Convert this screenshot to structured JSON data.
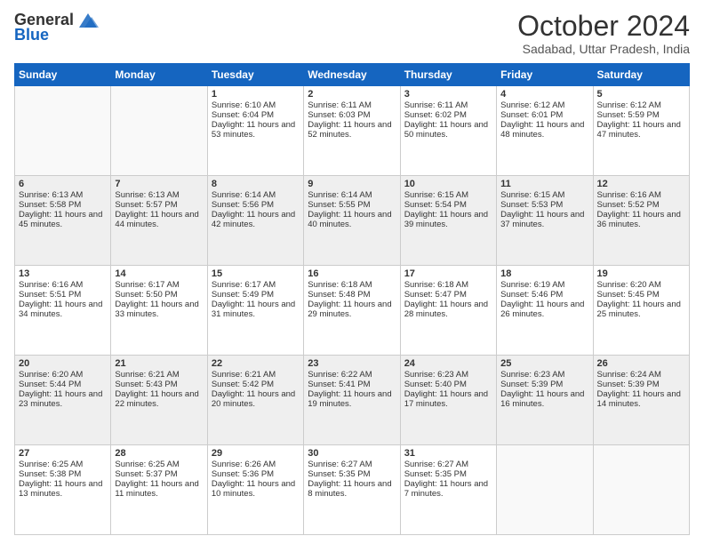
{
  "logo": {
    "line1": "General",
    "line2": "Blue"
  },
  "title": "October 2024",
  "subtitle": "Sadabad, Uttar Pradesh, India",
  "headers": [
    "Sunday",
    "Monday",
    "Tuesday",
    "Wednesday",
    "Thursday",
    "Friday",
    "Saturday"
  ],
  "weeks": [
    [
      {
        "day": "",
        "sunrise": "",
        "sunset": "",
        "daylight": ""
      },
      {
        "day": "",
        "sunrise": "",
        "sunset": "",
        "daylight": ""
      },
      {
        "day": "1",
        "sunrise": "Sunrise: 6:10 AM",
        "sunset": "Sunset: 6:04 PM",
        "daylight": "Daylight: 11 hours and 53 minutes."
      },
      {
        "day": "2",
        "sunrise": "Sunrise: 6:11 AM",
        "sunset": "Sunset: 6:03 PM",
        "daylight": "Daylight: 11 hours and 52 minutes."
      },
      {
        "day": "3",
        "sunrise": "Sunrise: 6:11 AM",
        "sunset": "Sunset: 6:02 PM",
        "daylight": "Daylight: 11 hours and 50 minutes."
      },
      {
        "day": "4",
        "sunrise": "Sunrise: 6:12 AM",
        "sunset": "Sunset: 6:01 PM",
        "daylight": "Daylight: 11 hours and 48 minutes."
      },
      {
        "day": "5",
        "sunrise": "Sunrise: 6:12 AM",
        "sunset": "Sunset: 5:59 PM",
        "daylight": "Daylight: 11 hours and 47 minutes."
      }
    ],
    [
      {
        "day": "6",
        "sunrise": "Sunrise: 6:13 AM",
        "sunset": "Sunset: 5:58 PM",
        "daylight": "Daylight: 11 hours and 45 minutes."
      },
      {
        "day": "7",
        "sunrise": "Sunrise: 6:13 AM",
        "sunset": "Sunset: 5:57 PM",
        "daylight": "Daylight: 11 hours and 44 minutes."
      },
      {
        "day": "8",
        "sunrise": "Sunrise: 6:14 AM",
        "sunset": "Sunset: 5:56 PM",
        "daylight": "Daylight: 11 hours and 42 minutes."
      },
      {
        "day": "9",
        "sunrise": "Sunrise: 6:14 AM",
        "sunset": "Sunset: 5:55 PM",
        "daylight": "Daylight: 11 hours and 40 minutes."
      },
      {
        "day": "10",
        "sunrise": "Sunrise: 6:15 AM",
        "sunset": "Sunset: 5:54 PM",
        "daylight": "Daylight: 11 hours and 39 minutes."
      },
      {
        "day": "11",
        "sunrise": "Sunrise: 6:15 AM",
        "sunset": "Sunset: 5:53 PM",
        "daylight": "Daylight: 11 hours and 37 minutes."
      },
      {
        "day": "12",
        "sunrise": "Sunrise: 6:16 AM",
        "sunset": "Sunset: 5:52 PM",
        "daylight": "Daylight: 11 hours and 36 minutes."
      }
    ],
    [
      {
        "day": "13",
        "sunrise": "Sunrise: 6:16 AM",
        "sunset": "Sunset: 5:51 PM",
        "daylight": "Daylight: 11 hours and 34 minutes."
      },
      {
        "day": "14",
        "sunrise": "Sunrise: 6:17 AM",
        "sunset": "Sunset: 5:50 PM",
        "daylight": "Daylight: 11 hours and 33 minutes."
      },
      {
        "day": "15",
        "sunrise": "Sunrise: 6:17 AM",
        "sunset": "Sunset: 5:49 PM",
        "daylight": "Daylight: 11 hours and 31 minutes."
      },
      {
        "day": "16",
        "sunrise": "Sunrise: 6:18 AM",
        "sunset": "Sunset: 5:48 PM",
        "daylight": "Daylight: 11 hours and 29 minutes."
      },
      {
        "day": "17",
        "sunrise": "Sunrise: 6:18 AM",
        "sunset": "Sunset: 5:47 PM",
        "daylight": "Daylight: 11 hours and 28 minutes."
      },
      {
        "day": "18",
        "sunrise": "Sunrise: 6:19 AM",
        "sunset": "Sunset: 5:46 PM",
        "daylight": "Daylight: 11 hours and 26 minutes."
      },
      {
        "day": "19",
        "sunrise": "Sunrise: 6:20 AM",
        "sunset": "Sunset: 5:45 PM",
        "daylight": "Daylight: 11 hours and 25 minutes."
      }
    ],
    [
      {
        "day": "20",
        "sunrise": "Sunrise: 6:20 AM",
        "sunset": "Sunset: 5:44 PM",
        "daylight": "Daylight: 11 hours and 23 minutes."
      },
      {
        "day": "21",
        "sunrise": "Sunrise: 6:21 AM",
        "sunset": "Sunset: 5:43 PM",
        "daylight": "Daylight: 11 hours and 22 minutes."
      },
      {
        "day": "22",
        "sunrise": "Sunrise: 6:21 AM",
        "sunset": "Sunset: 5:42 PM",
        "daylight": "Daylight: 11 hours and 20 minutes."
      },
      {
        "day": "23",
        "sunrise": "Sunrise: 6:22 AM",
        "sunset": "Sunset: 5:41 PM",
        "daylight": "Daylight: 11 hours and 19 minutes."
      },
      {
        "day": "24",
        "sunrise": "Sunrise: 6:23 AM",
        "sunset": "Sunset: 5:40 PM",
        "daylight": "Daylight: 11 hours and 17 minutes."
      },
      {
        "day": "25",
        "sunrise": "Sunrise: 6:23 AM",
        "sunset": "Sunset: 5:39 PM",
        "daylight": "Daylight: 11 hours and 16 minutes."
      },
      {
        "day": "26",
        "sunrise": "Sunrise: 6:24 AM",
        "sunset": "Sunset: 5:39 PM",
        "daylight": "Daylight: 11 hours and 14 minutes."
      }
    ],
    [
      {
        "day": "27",
        "sunrise": "Sunrise: 6:25 AM",
        "sunset": "Sunset: 5:38 PM",
        "daylight": "Daylight: 11 hours and 13 minutes."
      },
      {
        "day": "28",
        "sunrise": "Sunrise: 6:25 AM",
        "sunset": "Sunset: 5:37 PM",
        "daylight": "Daylight: 11 hours and 11 minutes."
      },
      {
        "day": "29",
        "sunrise": "Sunrise: 6:26 AM",
        "sunset": "Sunset: 5:36 PM",
        "daylight": "Daylight: 11 hours and 10 minutes."
      },
      {
        "day": "30",
        "sunrise": "Sunrise: 6:27 AM",
        "sunset": "Sunset: 5:35 PM",
        "daylight": "Daylight: 11 hours and 8 minutes."
      },
      {
        "day": "31",
        "sunrise": "Sunrise: 6:27 AM",
        "sunset": "Sunset: 5:35 PM",
        "daylight": "Daylight: 11 hours and 7 minutes."
      },
      {
        "day": "",
        "sunrise": "",
        "sunset": "",
        "daylight": ""
      },
      {
        "day": "",
        "sunrise": "",
        "sunset": "",
        "daylight": ""
      }
    ]
  ]
}
